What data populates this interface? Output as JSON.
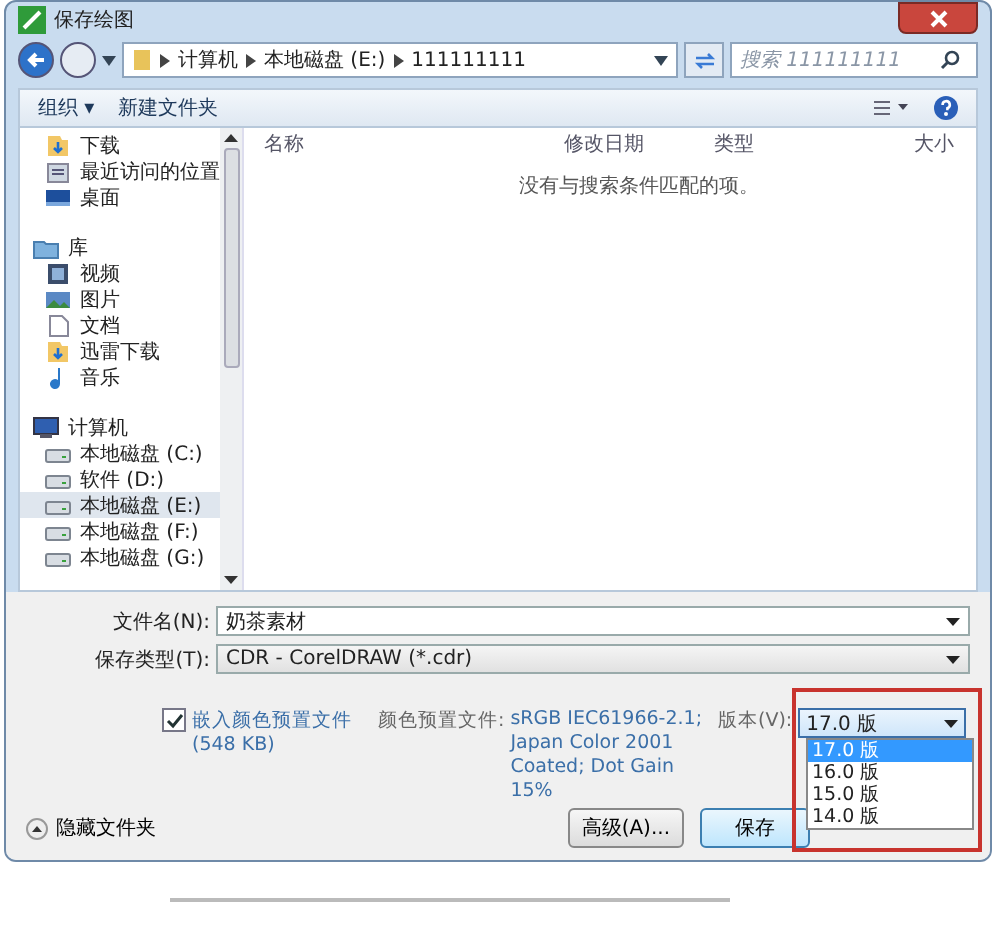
{
  "window": {
    "title": "保存绘图"
  },
  "address": {
    "path": [
      "计算机",
      "本地磁盘 (E:)",
      "111111111"
    ],
    "search_placeholder": "搜索 111111111"
  },
  "toolbar": {
    "organize": "组织 ▾",
    "new_folder": "新建文件夹"
  },
  "nav": [
    {
      "label": "下载",
      "selected": false
    },
    {
      "label": "最近访问的位置",
      "selected": false
    },
    {
      "label": "桌面",
      "selected": false
    },
    {
      "label": "库",
      "selected": false,
      "children": [
        {
          "label": "视频",
          "selected": false
        },
        {
          "label": "图片",
          "selected": false
        },
        {
          "label": "文档",
          "selected": false
        },
        {
          "label": "迅雷下载",
          "selected": false
        },
        {
          "label": "音乐",
          "selected": false
        }
      ]
    },
    {
      "label": "计算机",
      "selected": false,
      "children": [
        {
          "label": "本地磁盘 (C:)",
          "selected": false
        },
        {
          "label": "软件 (D:)",
          "selected": false
        },
        {
          "label": "本地磁盘 (E:)",
          "selected": true
        },
        {
          "label": "本地磁盘 (F:)",
          "selected": false
        },
        {
          "label": "本地磁盘 (G:)",
          "selected": false
        }
      ]
    }
  ],
  "table": {
    "columns": [
      "名称",
      "修改日期",
      "类型",
      "大小"
    ],
    "empty_message": "没有与搜索条件匹配的项。"
  },
  "form": {
    "filename_label": "文件名(N):",
    "filename": "奶茶素材",
    "type_label": "保存类型(T):",
    "type": "CDR - CorelDRAW (*.cdr)"
  },
  "options": {
    "embed": {
      "label": "嵌入颜色预置文件 (548 KB)",
      "checked": true
    },
    "profile_label": "颜色预置文件:",
    "profile_value": "sRGB IEC61966-2.1; Japan Color 2001 Coated; Dot Gain 15%",
    "version_label": "版本(V):",
    "version": "17.0 版",
    "version_list": [
      {
        "label": "17.0 版",
        "selected": true
      },
      {
        "label": "16.0 版",
        "selected": false
      },
      {
        "label": "15.0 版",
        "selected": false
      },
      {
        "label": "14.0 版",
        "selected": false
      }
    ]
  },
  "buttons": {
    "advanced": "高级(A)...",
    "save": "保存",
    "hide_folders": "隐藏文件夹"
  },
  "annotation": {
    "kind": "highlight-box"
  }
}
